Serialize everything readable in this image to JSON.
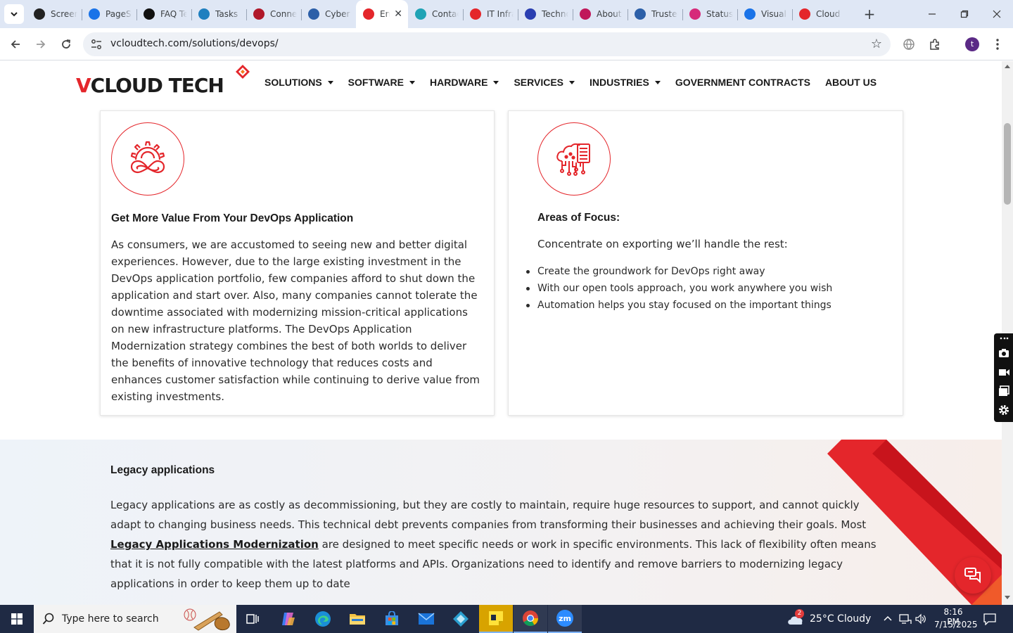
{
  "browser": {
    "tabs": [
      {
        "title": "Screencast",
        "fav_color": "#222222",
        "icon": "screencast-icon"
      },
      {
        "title": "PageSpeed",
        "fav_color": "#1a73e8",
        "icon": "pagespeed-icon"
      },
      {
        "title": "FAQ Tech",
        "fav_color": "#111111",
        "icon": "faq-icon"
      },
      {
        "title": "Tasks",
        "fav_color": "#1f7fbf",
        "icon": "tasks-icon"
      },
      {
        "title": "Connect",
        "fav_color": "#b0182a",
        "icon": "vcloud-v-icon"
      },
      {
        "title": "Cyber",
        "fav_color": "#2c5fa8",
        "icon": "cyber-icon"
      },
      {
        "title": "Enterprise",
        "fav_color": "#e4262b",
        "icon": "vcloud-diamond-icon",
        "active": true
      },
      {
        "title": "Contact",
        "fav_color": "#1fa3b5",
        "icon": "contact-icon"
      },
      {
        "title": "IT Infrastructure",
        "fav_color": "#e4262b",
        "icon": "vcloud-diamond-icon"
      },
      {
        "title": "Technology",
        "fav_color": "#2a3eb1",
        "icon": "x-icon"
      },
      {
        "title": "About",
        "fav_color": "#c0185a",
        "icon": "about-icon"
      },
      {
        "title": "Trusted",
        "fav_color": "#2c5fa8",
        "icon": "scale-icon"
      },
      {
        "title": "Status",
        "fav_color": "#d62a7a",
        "icon": "status-icon"
      },
      {
        "title": "Visual",
        "fav_color": "#1a73e8",
        "icon": "pulse-icon"
      },
      {
        "title": "Cloud",
        "fav_color": "#e4262b",
        "icon": "cloud-brush-icon"
      }
    ],
    "url": "vcloudtech.com/solutions/devops/",
    "profile_initial": "t"
  },
  "site": {
    "logo_text_v": "V",
    "logo_text_rest": "CLOUD TECH",
    "brand_color": "#e4262b",
    "nav": [
      {
        "label": "SOLUTIONS",
        "dropdown": true
      },
      {
        "label": "SOFTWARE",
        "dropdown": true
      },
      {
        "label": "HARDWARE",
        "dropdown": true
      },
      {
        "label": "SERVICES",
        "dropdown": true
      },
      {
        "label": "INDUSTRIES",
        "dropdown": true
      },
      {
        "label": "GOVERNMENT CONTRACTS",
        "dropdown": false
      },
      {
        "label": "ABOUT US",
        "dropdown": false
      }
    ]
  },
  "cards": {
    "left": {
      "icon": "gear-infinity-icon",
      "title": "Get More Value From Your DevOps Application",
      "body": "As consumers, we are accustomed to seeing new and better digital experiences. However, due to the large existing investment in the DevOps application portfolio, few companies afford to shut down the application and start over. Also, many companies cannot tolerate the downtime associated with modernizing mission-critical applications on new infrastructure platforms. The DevOps Application Modernization strategy combines the best of both worlds to deliver the benefits of innovative technology that reduces costs and enhances customer satisfaction while continuing to derive value from existing investments."
    },
    "right": {
      "icon": "cloud-server-circuit-icon",
      "title": "Areas of Focus:",
      "intro": "Concentrate on exporting we’ll handle the rest:",
      "items": [
        "Create the groundwork for DevOps right away",
        "With our open tools approach, you work anywhere you wish",
        "Automation helps you stay focused on the important things"
      ]
    }
  },
  "legacy": {
    "title": "Legacy applications",
    "body_before": "Legacy applications are as costly as decommissioning, but they are costly to maintain, require huge resources to support, and cannot quickly adapt to changing business needs. This technical debt prevents companies from transforming their businesses and achieving their goals. Most ",
    "link_text": "Legacy Applications Modernization",
    "body_after": " are designed to meet specific needs or work in specific environments. This lack of flexibility often means that it is not fully compatible with the latest platforms and APIs. Organizations need to identify and remove barriers to modernizing legacy applications in order to keep them up to date"
  },
  "taskbar": {
    "search_placeholder": "Type here to search",
    "weather": "25°C  Cloudy",
    "weather_badge": "2",
    "time": "8:16 PM",
    "date": "7/15/2025"
  }
}
